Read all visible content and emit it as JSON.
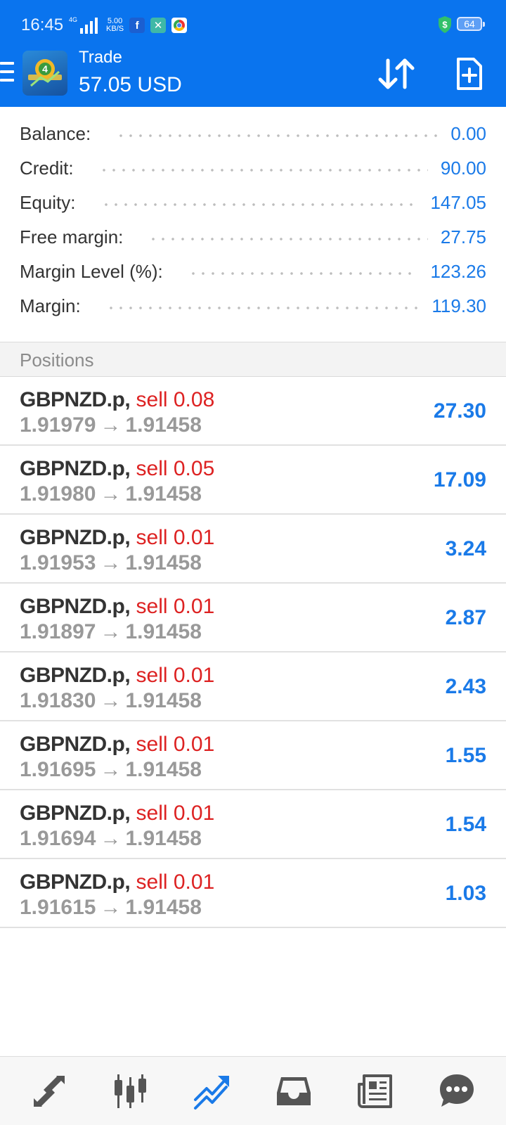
{
  "status_bar": {
    "time": "16:45",
    "network": "4G",
    "speed_value": "5.00",
    "speed_unit": "KB/S",
    "battery": "64"
  },
  "header": {
    "title": "Trade",
    "subtitle": "57.05 USD"
  },
  "summary": {
    "rows": [
      {
        "label": "Balance:",
        "value": "0.00"
      },
      {
        "label": "Credit:",
        "value": "90.00"
      },
      {
        "label": "Equity:",
        "value": "147.05"
      },
      {
        "label": "Free margin:",
        "value": "27.75"
      },
      {
        "label": "Margin Level (%):",
        "value": "123.26"
      },
      {
        "label": "Margin:",
        "value": "119.30"
      }
    ]
  },
  "positions": {
    "header": "Positions",
    "arrow": "→",
    "items": [
      {
        "symbol": "GBPNZD.p,",
        "side": "sell 0.08",
        "open_price": "1.91979",
        "current_price": "1.91458",
        "profit": "27.30"
      },
      {
        "symbol": "GBPNZD.p,",
        "side": "sell 0.05",
        "open_price": "1.91980",
        "current_price": "1.91458",
        "profit": "17.09"
      },
      {
        "symbol": "GBPNZD.p,",
        "side": "sell 0.01",
        "open_price": "1.91953",
        "current_price": "1.91458",
        "profit": "3.24"
      },
      {
        "symbol": "GBPNZD.p,",
        "side": "sell 0.01",
        "open_price": "1.91897",
        "current_price": "1.91458",
        "profit": "2.87"
      },
      {
        "symbol": "GBPNZD.p,",
        "side": "sell 0.01",
        "open_price": "1.91830",
        "current_price": "1.91458",
        "profit": "2.43"
      },
      {
        "symbol": "GBPNZD.p,",
        "side": "sell 0.01",
        "open_price": "1.91695",
        "current_price": "1.91458",
        "profit": "1.55"
      },
      {
        "symbol": "GBPNZD.p,",
        "side": "sell 0.01",
        "open_price": "1.91694",
        "current_price": "1.91458",
        "profit": "1.54"
      },
      {
        "symbol": "GBPNZD.p,",
        "side": "sell 0.01",
        "open_price": "1.91615",
        "current_price": "1.91458",
        "profit": "1.03"
      }
    ]
  },
  "bottom_nav": {
    "items": [
      {
        "icon": "quotes-icon",
        "active": false
      },
      {
        "icon": "chart-icon",
        "active": false
      },
      {
        "icon": "trade-icon",
        "active": true
      },
      {
        "icon": "history-icon",
        "active": false
      },
      {
        "icon": "news-icon",
        "active": false
      },
      {
        "icon": "messages-icon",
        "active": false
      }
    ]
  },
  "colors": {
    "header_bg": "#0a74ee",
    "accent": "#1a7ae8",
    "sell": "#dd2222",
    "nav_active": "#1a7ae8",
    "nav_inactive": "#555555"
  }
}
